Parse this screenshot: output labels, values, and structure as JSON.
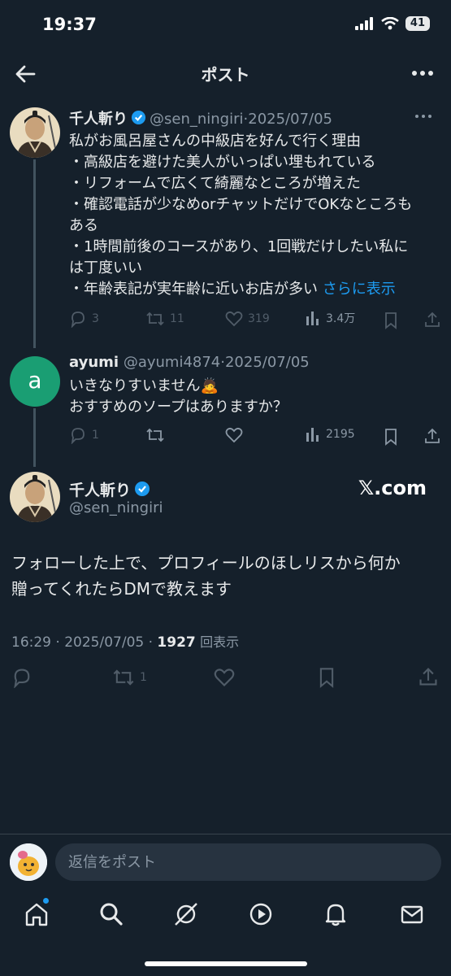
{
  "status": {
    "time": "19:37",
    "battery": "41"
  },
  "header": {
    "title": "ポスト"
  },
  "tweets": [
    {
      "name": "千人斬り",
      "handle": "@sen_ningiri",
      "date": "2025/07/05",
      "lines": [
        "私がお風呂屋さんの中級店を好んで行く理由",
        "・高級店を避けた美人がいっぱい埋もれている",
        "・リフォームで広くて綺麗なところが増えた",
        "・確認電話が少なめorチャットだけでOKなところも",
        "ある",
        "・1時間前後のコースがあり、1回戦だけしたい私に",
        "は丁度いい",
        "・年齢表記が実年齢に近いお店が多い "
      ],
      "show_more": "さらに表示",
      "replies": "3",
      "retweets": "11",
      "likes": "319",
      "views": "3.4万"
    },
    {
      "name": "ayumi",
      "avatar_letter": "a",
      "handle": "@ayumi4874",
      "date": "2025/07/05",
      "lines": [
        "いきなりすいません🙇",
        "おすすめのソープはありますか？"
      ],
      "replies": "1",
      "views": "2195"
    }
  ],
  "main": {
    "name": "千人斬り",
    "handle": "@sen_ningiri",
    "watermark": "𝕏.com",
    "lines": [
      "フォローした上で、プロフィールのほしリスから何か",
      "贈ってくれたらDMで教えます"
    ],
    "time": "16:29",
    "date": "2025/07/05",
    "views": "1927",
    "views_label": "回表示",
    "retweets": "1"
  },
  "reply": {
    "placeholder": "返信をポスト"
  },
  "colors": {
    "background": "#15202b",
    "accent": "#1d9bf0",
    "muted": "#8b98a5",
    "ayumi_avatar": "#1a9e73"
  },
  "tabs": [
    "home-icon",
    "search-icon",
    "grok-icon",
    "play-icon",
    "bell-icon",
    "mail-icon"
  ]
}
